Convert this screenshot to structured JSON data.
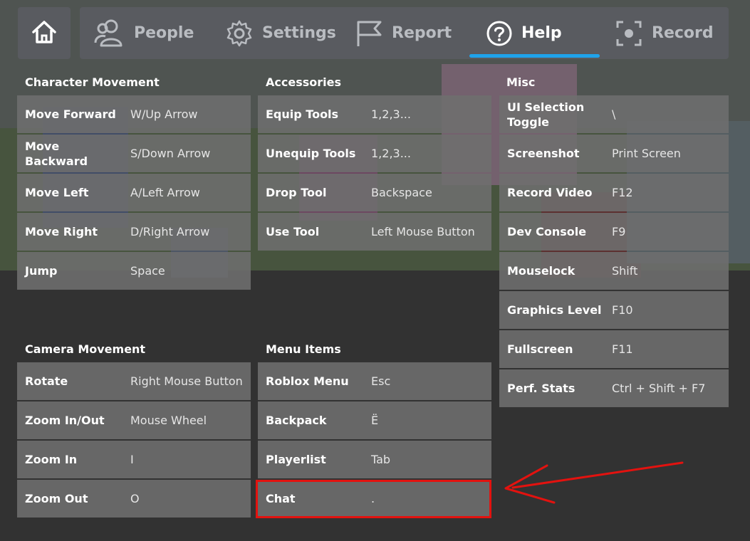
{
  "nav": {
    "tabs": [
      {
        "label": "People",
        "icon": "people-icon"
      },
      {
        "label": "Settings",
        "icon": "gear-icon"
      },
      {
        "label": "Report",
        "icon": "flag-icon"
      },
      {
        "label": "Help",
        "icon": "question-icon",
        "active": true
      },
      {
        "label": "Record",
        "icon": "record-icon"
      }
    ],
    "home_icon": "home-icon",
    "accent_color": "#1fa3ea"
  },
  "sections": {
    "character_movement": {
      "title": "Character Movement",
      "rows": [
        {
          "key": "Move Forward",
          "value": "W/Up Arrow"
        },
        {
          "key": "Move Backward",
          "value": "S/Down Arrow"
        },
        {
          "key": "Move Left",
          "value": "A/Left Arrow"
        },
        {
          "key": "Move Right",
          "value": "D/Right Arrow"
        },
        {
          "key": "Jump",
          "value": "Space"
        }
      ]
    },
    "accessories": {
      "title": "Accessories",
      "rows": [
        {
          "key": "Equip Tools",
          "value": "1,2,3..."
        },
        {
          "key": "Unequip Tools",
          "value": "1,2,3..."
        },
        {
          "key": "Drop Tool",
          "value": "Backspace"
        },
        {
          "key": "Use Tool",
          "value": "Left Mouse Button"
        }
      ]
    },
    "misc": {
      "title": "Misc",
      "rows": [
        {
          "key": "UI Selection Toggle",
          "value": "\\"
        },
        {
          "key": "Screenshot",
          "value": "Print Screen"
        },
        {
          "key": "Record Video",
          "value": "F12"
        },
        {
          "key": "Dev Console",
          "value": "F9"
        },
        {
          "key": "Mouselock",
          "value": "Shift"
        },
        {
          "key": "Graphics Level",
          "value": "F10"
        },
        {
          "key": "Fullscreen",
          "value": "F11"
        },
        {
          "key": "Perf. Stats",
          "value": "Ctrl + Shift + F7"
        }
      ]
    },
    "camera_movement": {
      "title": "Camera Movement",
      "rows": [
        {
          "key": "Rotate",
          "value": "Right Mouse Button"
        },
        {
          "key": "Zoom In/Out",
          "value": "Mouse Wheel"
        },
        {
          "key": "Zoom In",
          "value": "I"
        },
        {
          "key": "Zoom Out",
          "value": "O"
        }
      ]
    },
    "menu_items": {
      "title": "Menu Items",
      "rows": [
        {
          "key": "Roblox Menu",
          "value": "Esc"
        },
        {
          "key": "Backpack",
          "value": "Ё"
        },
        {
          "key": "Playerlist",
          "value": "Tab"
        },
        {
          "key": "Chat",
          "value": "."
        }
      ]
    }
  },
  "annotation": {
    "highlight_color": "#e3120f"
  }
}
